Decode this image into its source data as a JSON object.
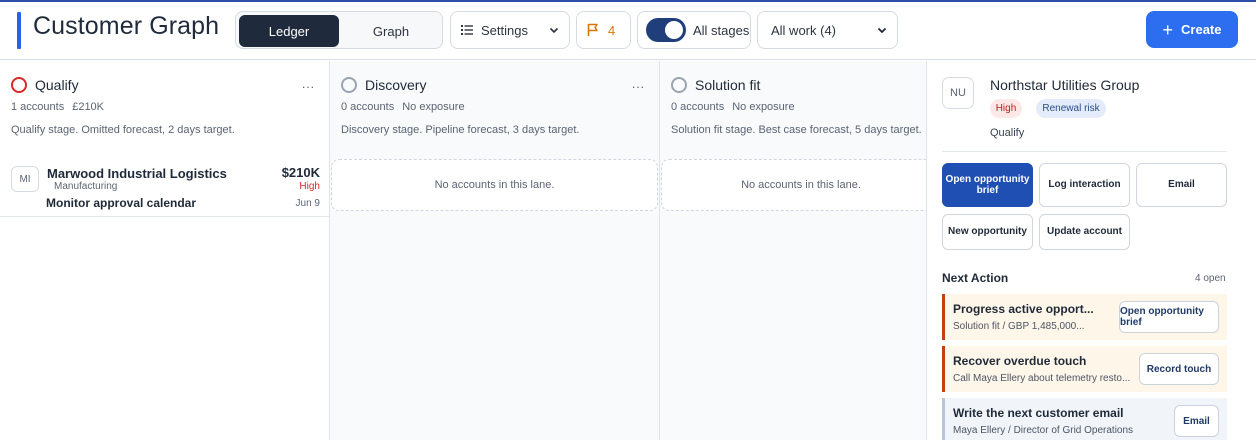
{
  "header": {
    "title": "Customer Graph",
    "view_tabs": [
      {
        "label": "Ledger"
      },
      {
        "label": "Graph"
      }
    ],
    "settings_label": "Settings",
    "flag_count": "4",
    "stages_label": "All stages",
    "stages_toggle_on": true,
    "work_filter": "All work (4)",
    "create_label": "Create"
  },
  "lanes": [
    {
      "name": "Qualify",
      "accounts": "1 accounts",
      "exposure": "£210K",
      "description": "Qualify stage. Omitted forecast, 2 days target.",
      "more": "...",
      "card": {
        "avatar": "MI",
        "name": "Marwood Industrial Logistics",
        "industry": "Manufacturing",
        "amount": "$210K",
        "priority": "High",
        "task": "Monitor approval calendar",
        "date": "Jun 9"
      }
    },
    {
      "name": "Discovery",
      "accounts": "0 accounts",
      "exposure": "No exposure",
      "description": "Discovery stage. Pipeline forecast, 3 days target.",
      "more": "...",
      "empty": "No accounts in this lane."
    },
    {
      "name": "Solution fit",
      "accounts": "0 accounts",
      "exposure": "No exposure",
      "description": "Solution fit stage. Best case forecast, 5 days target.",
      "empty": "No accounts in this lane."
    }
  ],
  "panel": {
    "avatar": "NU",
    "name": "Northstar Utilities Group",
    "badges": [
      "High",
      "Renewal risk"
    ],
    "stage": "Qualify",
    "actions": [
      {
        "label": "Open opportunity brief"
      },
      {
        "label": "Log interaction"
      },
      {
        "label": "Email"
      },
      {
        "label": "New opportunity"
      },
      {
        "label": "Update account"
      }
    ],
    "next_action_title": "Next Action",
    "next_action_count": "4 open",
    "next_actions": [
      {
        "title": "Progress active opport...",
        "detail": "Solution fit / GBP 1,485,000...",
        "button": "Open opportunity brief"
      },
      {
        "title": "Recover overdue touch",
        "detail": "Call Maya Ellery about telemetry resto...",
        "button": "Record touch"
      },
      {
        "title": "Write the next customer email",
        "detail": "Maya Ellery / Director of Grid Operations",
        "button": "Email"
      }
    ]
  },
  "colors": {
    "accent": "#2563eb",
    "primary_dark": "#1f2a3c",
    "danger": "#dc2626",
    "warning": "#d97706"
  }
}
